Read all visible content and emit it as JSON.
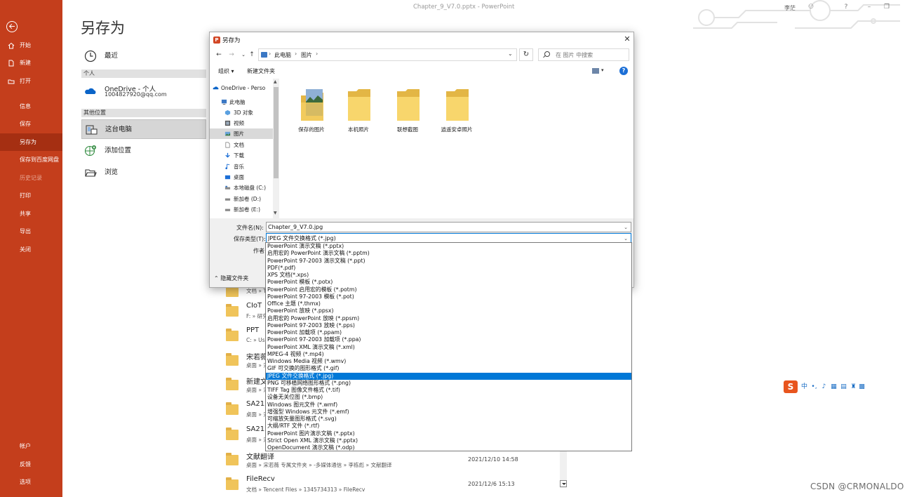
{
  "window": {
    "title": "Chapter_9_V7.0.pptx - PowerPoint",
    "user": "李茫",
    "controls": {
      "person": "⚇",
      "help": "?",
      "minimize": "–",
      "restore": "❐"
    }
  },
  "nav": {
    "items": [
      {
        "label": "开始",
        "icon": "home-icon"
      },
      {
        "label": "新建",
        "icon": "new-document-icon"
      },
      {
        "label": "打开",
        "icon": "open-folder-icon"
      },
      {
        "label": "信息"
      },
      {
        "label": "保存"
      },
      {
        "label": "另存为",
        "active": true
      },
      {
        "label": "保存到百度网盘"
      },
      {
        "label": "历史记录",
        "disabled": true
      },
      {
        "label": "打印"
      },
      {
        "label": "共享"
      },
      {
        "label": "导出"
      },
      {
        "label": "关闭"
      }
    ],
    "bottom": [
      {
        "label": "帐户"
      },
      {
        "label": "反馈"
      },
      {
        "label": "选项"
      }
    ]
  },
  "backstage": {
    "title": "另存为",
    "recent": "最近",
    "section_personal": "个人",
    "onedrive_name": "OneDrive - 个人",
    "onedrive_email": "1004827920@qq.com",
    "section_other": "其他位置",
    "this_pc": "这台电脑",
    "add_place": "添加位置",
    "browse": "浏览"
  },
  "folders": [
    {
      "name": "",
      "path": "文档 » T",
      "date": ""
    },
    {
      "name": "CIoT",
      "path": "F: » 研究",
      "date": ""
    },
    {
      "name": "PPT",
      "path": "C: » Use",
      "date": ""
    },
    {
      "name": "宋若薇",
      "path": "桌面 » 宋",
      "date": ""
    },
    {
      "name": "新建文",
      "path": "桌面 » 宋",
      "date": ""
    },
    {
      "name": "SA212",
      "path": "桌面 » 宋",
      "date": ""
    },
    {
      "name": "SA212",
      "path": "桌面 » 宋",
      "date": ""
    },
    {
      "name": "文献翻译",
      "path": "桌面 » 宋若薇 专属文件夹 » -多媒体通信 » 李栋彪 » 文献翻译",
      "date": "2021/12/10 14:58"
    },
    {
      "name": "FileRecv",
      "path": "文档 » Tencent Files » 1345734313 » FileRecv",
      "date": "2021/12/6 15:13"
    }
  ],
  "dialog": {
    "title": "另存为",
    "close": "✕",
    "nav": {
      "back": "←",
      "forward": "→",
      "recent": "⌄",
      "up": "↑"
    },
    "address": [
      "此电脑",
      "图片"
    ],
    "refresh": "↻",
    "search_placeholder": "在 图片 中搜索",
    "organize": "组织 ▾",
    "new_folder": "新建文件夹",
    "help": "?",
    "tree": [
      {
        "label": "OneDrive - Perso",
        "icon": "cloud-icon"
      },
      {
        "label": "此电脑",
        "icon": "computer-icon"
      },
      {
        "label": "3D 对象",
        "icon": "cube-icon"
      },
      {
        "label": "视频",
        "icon": "video-icon"
      },
      {
        "label": "图片",
        "icon": "pictures-icon",
        "selected": true
      },
      {
        "label": "文档",
        "icon": "document-icon"
      },
      {
        "label": "下载",
        "icon": "download-icon"
      },
      {
        "label": "音乐",
        "icon": "music-icon"
      },
      {
        "label": "桌面",
        "icon": "desktop-icon"
      },
      {
        "label": "本地磁盘 (C:)",
        "icon": "drive-icon"
      },
      {
        "label": "新加卷 (D:)",
        "icon": "drive-icon"
      },
      {
        "label": "新加卷 (E:)",
        "icon": "drive-icon"
      }
    ],
    "files": [
      {
        "label": "保存的图片",
        "thumb": true
      },
      {
        "label": "本机照片"
      },
      {
        "label": "联想截图"
      },
      {
        "label": "逍遥安卓照片"
      }
    ],
    "filename_label": "文件名(N):",
    "filename": "Chapter_9_V7.0.jpg",
    "filetype_label": "保存类型(T):",
    "filetype": "JPEG 文件交换格式 (*.jpg)",
    "author_label": "作者:",
    "hide_folders": "隐藏文件夹"
  },
  "filetypes": [
    "PowerPoint 演示文稿 (*.pptx)",
    "启用宏的 PowerPoint 演示文稿 (*.pptm)",
    "PowerPoint 97-2003 演示文稿 (*.ppt)",
    "PDF(*.pdf)",
    "XPS 文档(*.xps)",
    "PowerPoint 模板 (*.potx)",
    "PowerPoint 启用宏的模板 (*.potm)",
    "PowerPoint 97-2003 模板 (*.pot)",
    "Office 主题 (*.thmx)",
    "PowerPoint 放映 (*.ppsx)",
    "启用宏的 PowerPoint 放映 (*.ppsm)",
    "PowerPoint 97-2003 放映 (*.pps)",
    "PowerPoint 加载项 (*.ppam)",
    "PowerPoint 97-2003 加载项 (*.ppa)",
    "PowerPoint XML 演示文稿 (*.xml)",
    "MPEG-4 视频 (*.mp4)",
    "Windows Media 视频 (*.wmv)",
    "GIF 可交换的图形格式 (*.gif)",
    "JPEG 文件交换格式 (*.jpg)",
    "PNG 可移植网络图形格式 (*.png)",
    "TIFF Tag 图像文件格式 (*.tif)",
    "设备无关位图 (*.bmp)",
    "Windows 图元文件 (*.wmf)",
    "增强型 Windows 元文件 (*.emf)",
    "可缩放矢量图形格式 (*.svg)",
    "大纲/RTF 文件 (*.rtf)",
    "PowerPoint 图片演示文稿 (*.pptx)",
    "Strict Open XML 演示文稿 (*.pptx)",
    "OpenDocument 演示文稿 (*.odp)"
  ],
  "selected_filetype_index": 18,
  "ime": {
    "logo": "S",
    "glyphs": [
      "中",
      "•,",
      "♪",
      "▦",
      "▤",
      "♜",
      "▩"
    ]
  },
  "watermark": "CSDN @CRMONALDO",
  "colors": {
    "accent": "#c43e1c",
    "selection": "#0078d7"
  }
}
